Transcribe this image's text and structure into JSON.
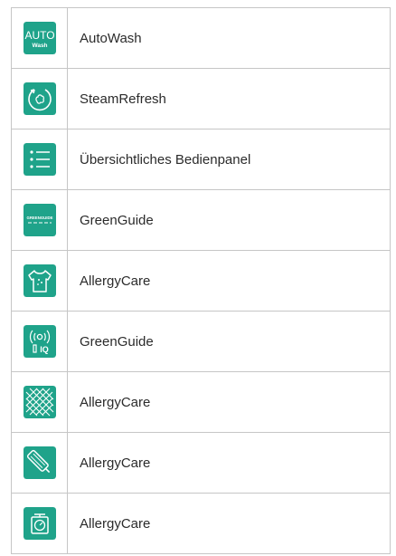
{
  "colors": {
    "icon_tile": "#1fa38a",
    "icon_stroke": "#ffffff",
    "border": "#c6c6c6",
    "text": "#2b2b2b"
  },
  "features": [
    {
      "icon": "auto-wash-icon",
      "icon_text": "AUTO",
      "icon_subtext": "Wash",
      "label": "AutoWash"
    },
    {
      "icon": "steam-refresh-icon",
      "label": "SteamRefresh"
    },
    {
      "icon": "control-panel-list-icon",
      "label": "Übersichtliches Bedienpanel"
    },
    {
      "icon": "green-guide-icon",
      "icon_text": "GREENGUIDE",
      "label": "GreenGuide"
    },
    {
      "icon": "allergy-shirt-icon",
      "label": "AllergyCare"
    },
    {
      "icon": "connectivity-iq-icon",
      "icon_text": "IQ",
      "label": "GreenGuide"
    },
    {
      "icon": "mesh-fabric-icon",
      "label": "AllergyCare"
    },
    {
      "icon": "cartridge-icon",
      "label": "AllergyCare"
    },
    {
      "icon": "weighing-scale-icon",
      "label": "AllergyCare"
    }
  ]
}
